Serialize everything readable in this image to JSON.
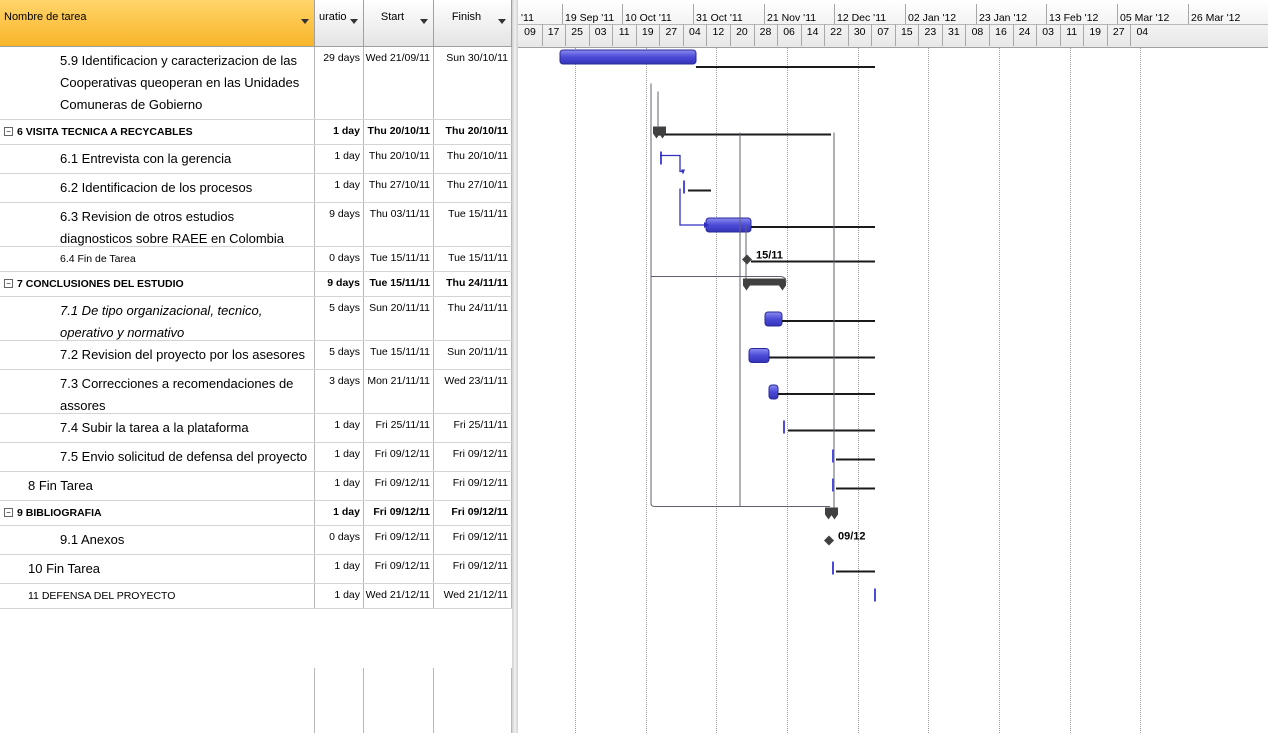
{
  "columns": {
    "name": "Nombre de tarea",
    "duration": "uratio",
    "start": "Start",
    "finish": "Finish"
  },
  "tasks": [
    {
      "lines": [
        "5.9 Identificacion y caracterizacion de las",
        "Cooperativas queoperan en las Unidades",
        "Comuneras de Gobierno"
      ],
      "duration": "29 days",
      "start": "Wed 21/09/11",
      "finish": "Sun 30/10/11"
    },
    {
      "lines": [
        "6 VISITA TECNICA A RECYCABLES"
      ],
      "duration": "1 day",
      "start": "Thu 20/10/11",
      "finish": "Thu 20/10/11"
    },
    {
      "lines": [
        "6.1 Entrevista con la gerencia"
      ],
      "duration": "1 day",
      "start": "Thu 20/10/11",
      "finish": "Thu 20/10/11"
    },
    {
      "lines": [
        "6.2 Identificacion de los procesos"
      ],
      "duration": "1 day",
      "start": "Thu 27/10/11",
      "finish": "Thu 27/10/11"
    },
    {
      "lines": [
        "6.3 Revision de otros estudios",
        "diagnosticos sobre RAEE en Colombia"
      ],
      "duration": "9 days",
      "start": "Thu 03/11/11",
      "finish": "Tue 15/11/11"
    },
    {
      "lines": [
        "6.4 Fin de Tarea"
      ],
      "duration": "0 days",
      "start": "Tue 15/11/11",
      "finish": "Tue 15/11/11"
    },
    {
      "lines": [
        "7 CONCLUSIONES DEL ESTUDIO"
      ],
      "duration": "9 days",
      "start": "Tue 15/11/11",
      "finish": "Thu 24/11/11"
    },
    {
      "lines": [
        "7.1 De tipo organizacional, tecnico,",
        "operativo y normativo"
      ],
      "duration": "5 days",
      "start": "Sun 20/11/11",
      "finish": "Thu 24/11/11"
    },
    {
      "lines": [
        "7.2 Revision del proyecto por los asesores"
      ],
      "duration": "5 days",
      "start": "Tue 15/11/11",
      "finish": "Sun 20/11/11"
    },
    {
      "lines": [
        "7.3 Correcciones a recomendaciones de",
        "assores"
      ],
      "duration": "3 days",
      "start": "Mon 21/11/11",
      "finish": "Wed 23/11/11"
    },
    {
      "lines": [
        "7.4 Subir la tarea a la plataforma"
      ],
      "duration": "1 day",
      "start": "Fri 25/11/11",
      "finish": "Fri 25/11/11"
    },
    {
      "lines": [
        "7.5 Envio solicitud de defensa del proyecto"
      ],
      "duration": "1 day",
      "start": "Fri 09/12/11",
      "finish": "Fri 09/12/11"
    },
    {
      "lines": [
        "8 Fin Tarea"
      ],
      "duration": "1 day",
      "start": "Fri 09/12/11",
      "finish": "Fri 09/12/11"
    },
    {
      "lines": [
        "9 BIBLIOGRAFIA"
      ],
      "duration": "1 day",
      "start": "Fri 09/12/11",
      "finish": "Fri 09/12/11"
    },
    {
      "lines": [
        "9.1 Anexos"
      ],
      "duration": "0 days",
      "start": "Fri 09/12/11",
      "finish": "Fri 09/12/11"
    },
    {
      "lines": [
        "10 Fin Tarea"
      ],
      "duration": "1 day",
      "start": "Fri 09/12/11",
      "finish": "Fri 09/12/11"
    },
    {
      "lines": [
        "11 DEFENSA DEL PROYECTO"
      ],
      "duration": "1 day",
      "start": "Wed 21/12/11",
      "finish": "Wed 21/12/11"
    }
  ],
  "timescale": {
    "months": [
      "'11",
      "19 Sep '11",
      "10 Oct '11",
      "31 Oct '11",
      "21 Nov '11",
      "12 Dec '11",
      "02 Jan '12",
      "23 Jan '12",
      "13 Feb '12",
      "05 Mar '12",
      "26 Mar '12"
    ],
    "days": [
      "09",
      "17",
      "25",
      "03",
      "11",
      "19",
      "27",
      "04",
      "12",
      "20",
      "28",
      "06",
      "14",
      "22",
      "30",
      "07",
      "15",
      "23",
      "31",
      "08",
      "16",
      "24",
      "03",
      "11",
      "19",
      "27",
      "04"
    ]
  },
  "milestone_labels": [
    "15/11",
    "09/12"
  ],
  "colors": {
    "bar": "#4b4bd8",
    "summary": "#404040",
    "link": "#3030c0",
    "header_accent": "#f8b52a"
  }
}
